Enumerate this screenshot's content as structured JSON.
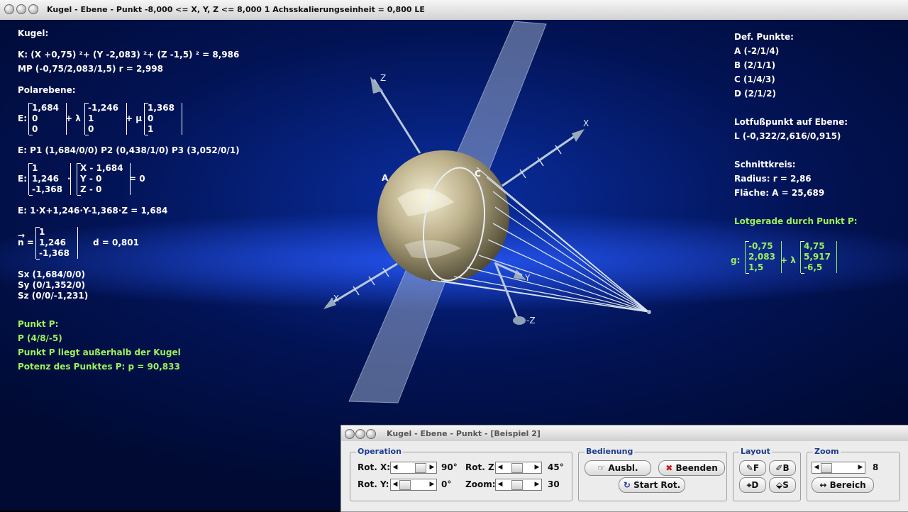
{
  "window": {
    "title": "Kugel - Ebene - Punkt   -8,000 <= X, Y, Z <= 8,000     1 Achsskalierungseinheit = 0,800 LE"
  },
  "left": {
    "heading": "Kugel:",
    "sphere_eq": "K: (X +0,75) ²+ (Y -2,083) ²+ (Z -1,5) ² = 8,986",
    "center": "MP (-0,75/2,083/1,5)  r = 2,998",
    "polar_heading": "Polarebene:",
    "E_label": "E:",
    "plane_param": {
      "p": [
        "1,684",
        "0",
        "0"
      ],
      "u": [
        "-1,246",
        "1",
        "0"
      ],
      "v": [
        "1,368",
        "0",
        "1"
      ],
      "plus_lambda": "+ λ",
      "plus_mu": "+ μ"
    },
    "points_line": "E: P1 (1,684/0/0)   P2 (0,438/1/0)   P3 (3,052/0/1)",
    "normal_form": {
      "n": [
        "1",
        "1,246",
        "-1,368"
      ],
      "x": [
        "X - 1,684",
        "Y - 0",
        "Z - 0"
      ],
      "dot": "·",
      "equals": "= 0"
    },
    "coord_form": "E: 1·X+1,246·Y-1,368·Z = 1,684",
    "n_vector": {
      "arrow": "→",
      "label": "n =",
      "values": [
        "1",
        "1,246",
        "-1,368"
      ],
      "distance": "d = 0,801"
    },
    "traces": [
      "Sx (1,684/0/0)",
      "Sy (0/1,352/0)",
      "Sz (0/0/-1,231)"
    ],
    "point_heading": "Punkt P:",
    "point": "P (4/8/-5)",
    "point_status": "Punkt P liegt außerhalb der Kugel",
    "power": "Potenz des Punktes P: p = 90,833"
  },
  "right": {
    "def_heading": "Def. Punkte:",
    "def_points": [
      "A (-2/1/4)",
      "B (2/1/1)",
      "C (1/4/3)",
      "D (2/1/2)"
    ],
    "foot_heading": "Lotfußpunkt auf Ebene:",
    "foot": "L (-0,322/2,616/0,915)",
    "circle_heading": "Schnittkreis:",
    "radius": "Radius: r = 2,86",
    "area": "Fläche: A = 25,689",
    "line_heading": "Lotgerade durch Punkt P:",
    "g_label": "g:",
    "g_point": [
      "-0,75",
      "2,083",
      "1,5"
    ],
    "g_dir": [
      "4,75",
      "5,917",
      "-6,5"
    ],
    "plus_lambda": "+ λ"
  },
  "scene_labels": {
    "z": "Z",
    "x": "X",
    "neg_x": "-X",
    "neg_z": "-Z",
    "y": "Y",
    "A": "A",
    "C": "C"
  },
  "panel": {
    "title": "Kugel - Ebene - Punkt - [Beispiel 2]",
    "operation": {
      "label": "Operation",
      "rot_x_label": "Rot. X:",
      "rot_x_value": "90°",
      "rot_y_label": "Rot. Y:",
      "rot_y_value": "0°",
      "rot_z_label": "Rot. Z:",
      "rot_z_value": "45°",
      "zoom_label": "Zoom:",
      "zoom_value": "30"
    },
    "bedienung": {
      "label": "Bedienung",
      "ausbl": "Ausbl.",
      "beenden": "Beenden",
      "start_rot": "Start Rot."
    },
    "layout": {
      "label": "Layout",
      "f": "F",
      "b": "B",
      "d": "D",
      "s": "S"
    },
    "zoom": {
      "label": "Zoom",
      "value": "8",
      "bereich": "Bereich"
    }
  }
}
